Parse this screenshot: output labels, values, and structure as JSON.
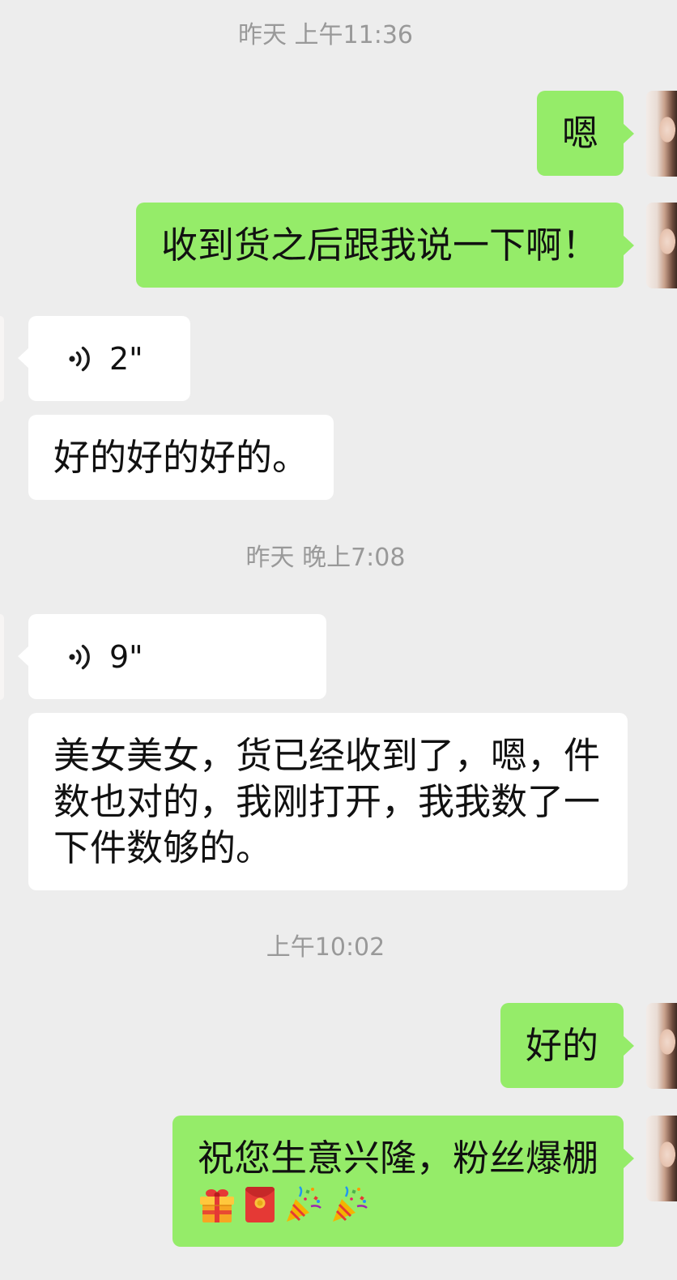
{
  "colors": {
    "page_background": "#EDEDED",
    "sent_bubble": "#95EC69",
    "received_bubble": "#FFFFFF",
    "timestamp_text": "#999999",
    "message_text": "#111111"
  },
  "messages": [
    {
      "timestamp": "昨天 上午11:36"
    },
    {
      "sent": {
        "text": "嗯"
      }
    },
    {
      "sent": {
        "text": "收到货之后跟我说一下啊！"
      }
    },
    {
      "received": {
        "voice_duration": "2\"",
        "icon": "voice-wave-icon"
      }
    },
    {
      "received": {
        "text": "好的好的好的。"
      }
    },
    {
      "timestamp": "昨天 晚上7:08"
    },
    {
      "received": {
        "voice_duration": "9\"",
        "icon": "voice-wave-icon"
      }
    },
    {
      "received": {
        "text": "美女美女，货已经收到了，嗯，件数也对的，我刚打开，我我数了一下件数够的。"
      }
    },
    {
      "timestamp": "上午10:02"
    },
    {
      "sent": {
        "text": "好的"
      }
    },
    {
      "sent": {
        "text": "祝您生意兴隆，粉丝爆棚",
        "emojis": [
          "gift-icon",
          "red-envelope-icon",
          "party-popper-icon",
          "party-popper-icon"
        ]
      }
    }
  ]
}
